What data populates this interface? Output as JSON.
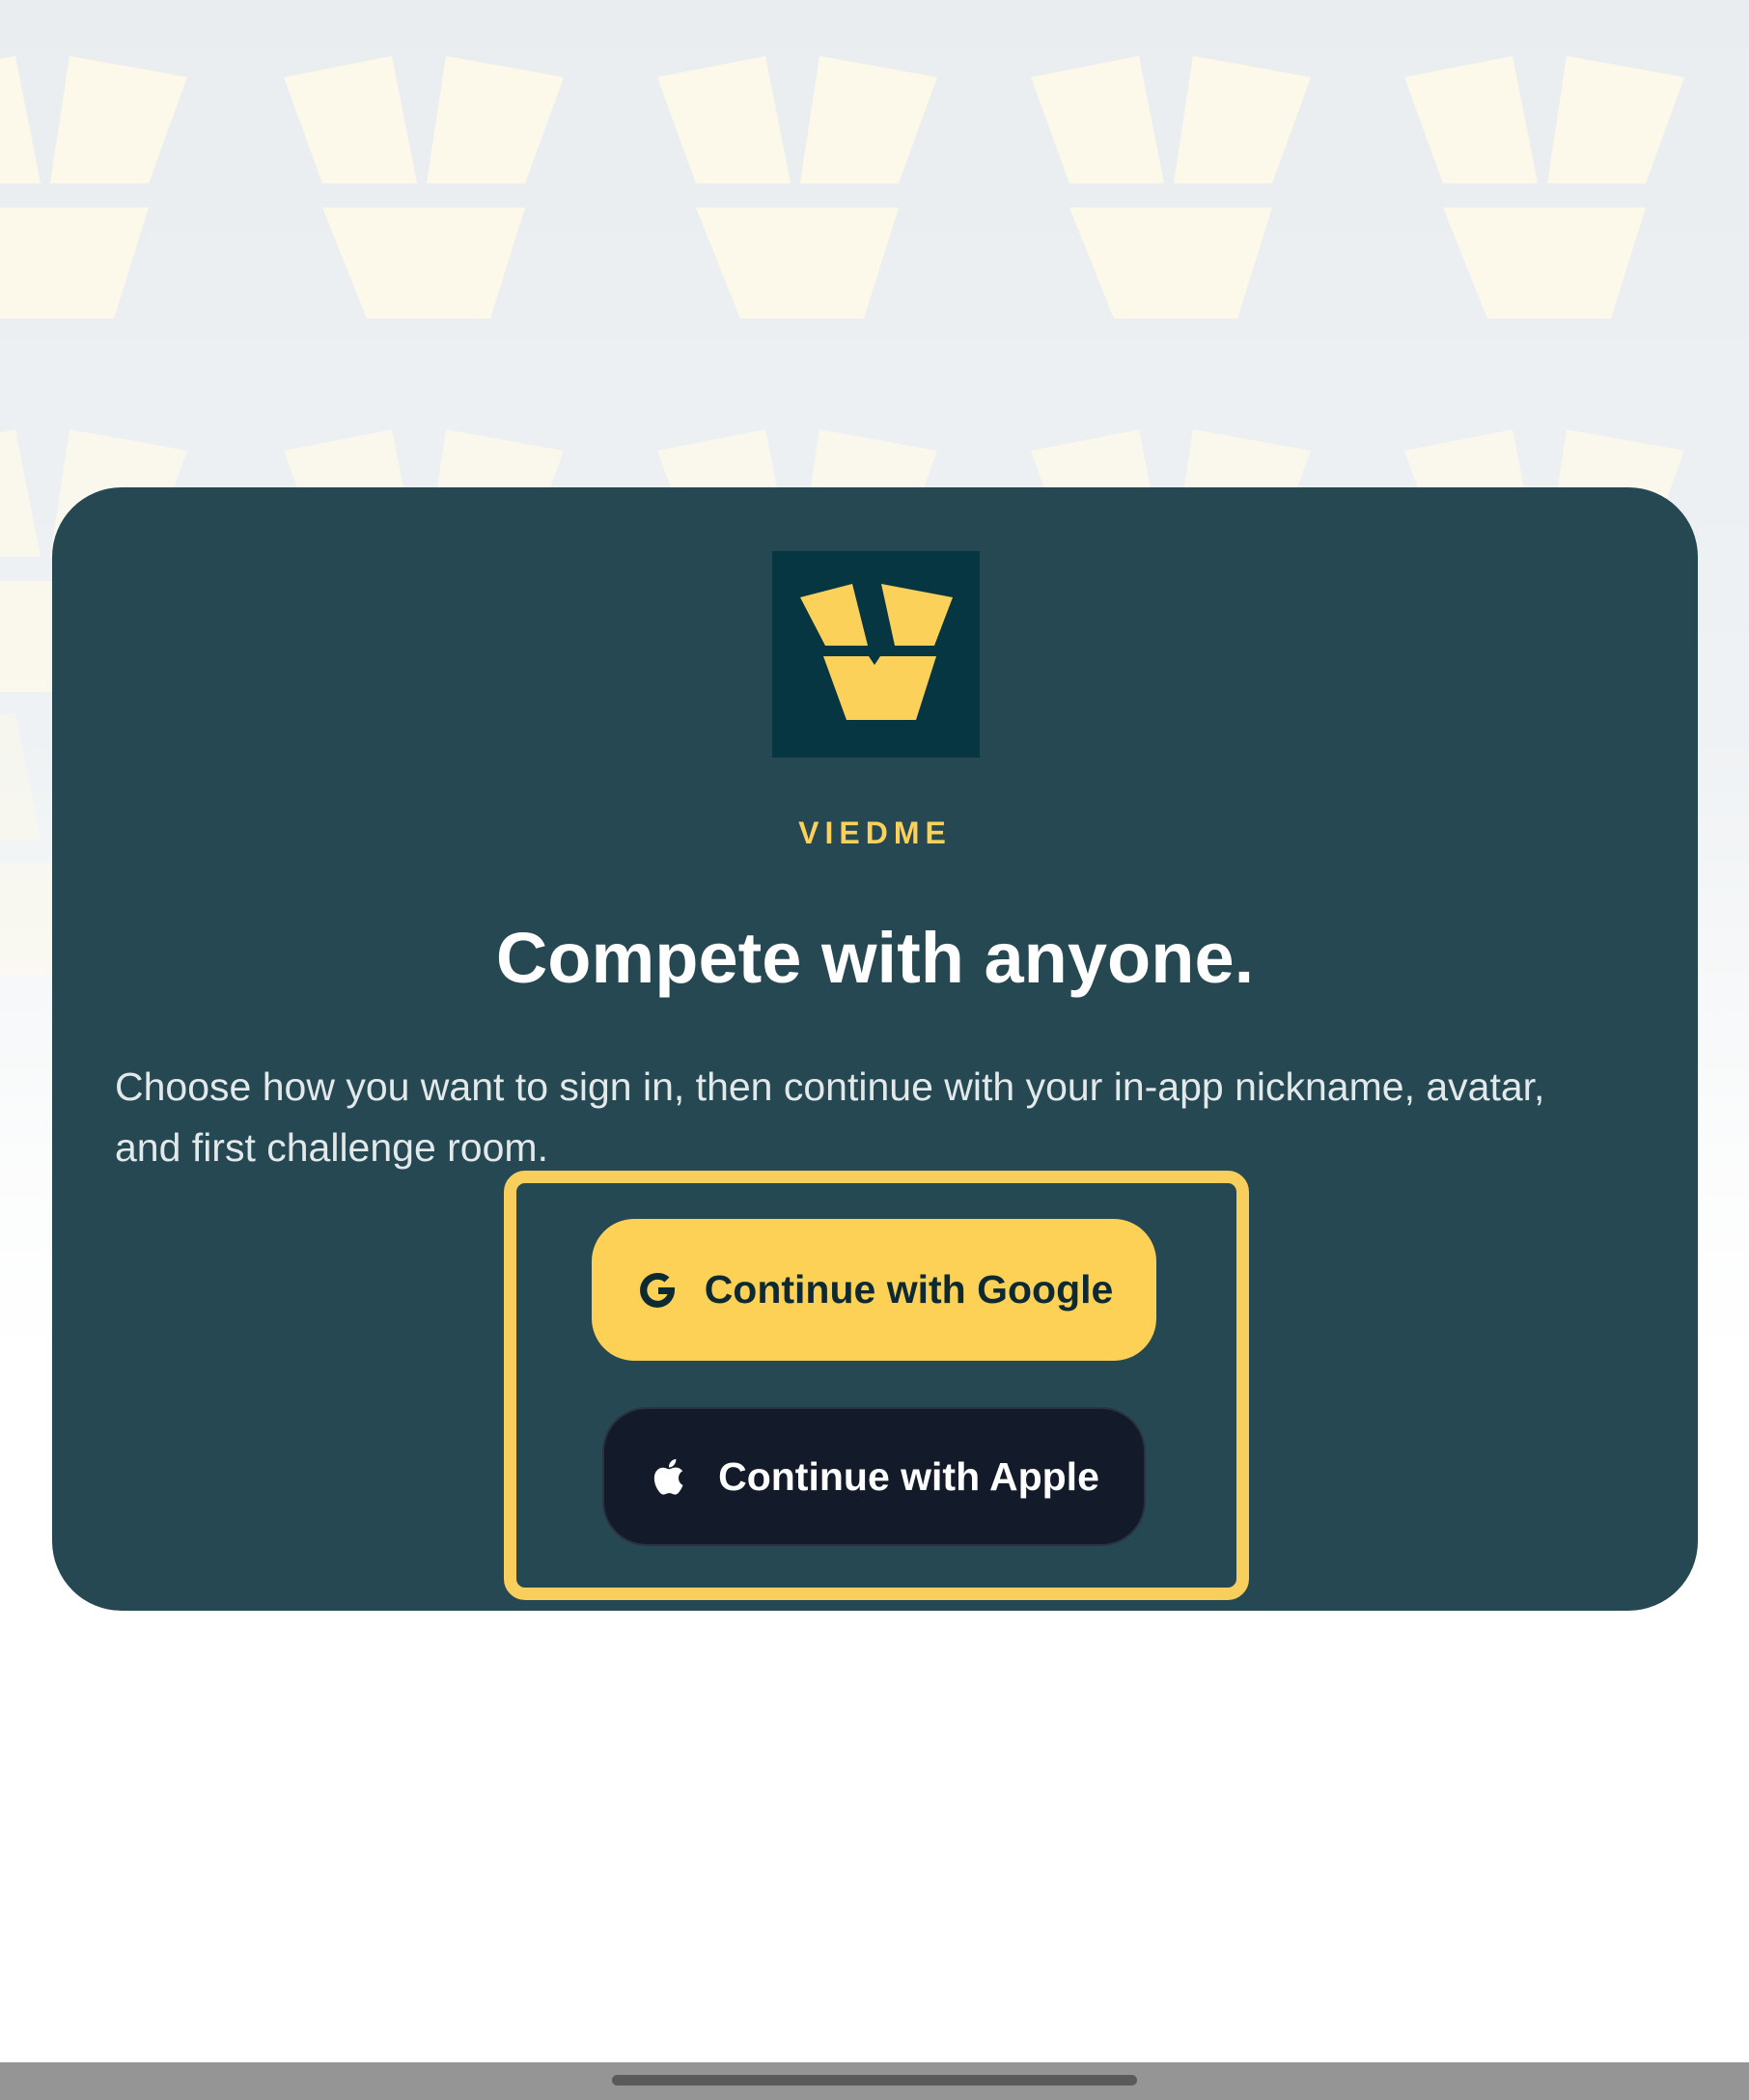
{
  "brand": {
    "name": "VIEDME",
    "logo_icon": "viedme-logo-icon",
    "accent_color": "#fcd15a",
    "logo_bg_color": "#073643"
  },
  "card": {
    "background_color": "#254852"
  },
  "headline": "Compete with anyone.",
  "subtext": "Choose how you want to sign in, then continue with your in-app nickname, avatar, and first challenge room.",
  "buttons": {
    "google": {
      "label": "Continue with Google",
      "icon": "google-icon",
      "color": "#fdd056"
    },
    "apple": {
      "label": "Continue with Apple",
      "icon": "apple-icon",
      "color": "#131a2a"
    }
  },
  "highlight": {
    "color": "#f8cf5d"
  },
  "system": {
    "home_indicator": "home-indicator"
  }
}
